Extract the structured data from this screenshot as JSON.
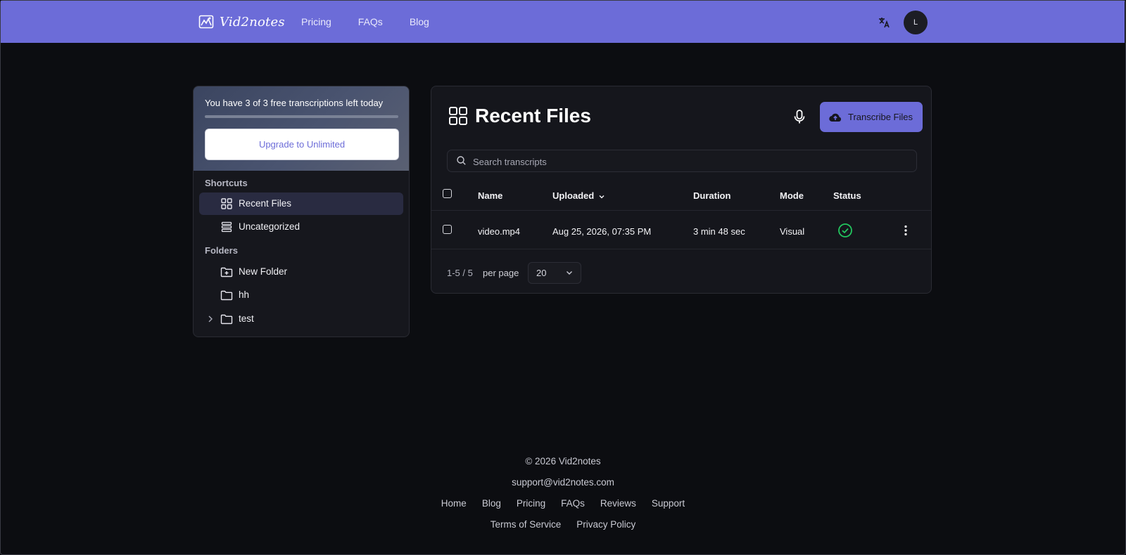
{
  "header": {
    "brand": "Vid2notes",
    "nav": [
      "Pricing",
      "FAQs",
      "Blog"
    ],
    "avatar_initial": "L",
    "bg_color": "#6c6cd8"
  },
  "sidebar": {
    "promo_text": "You have 3 of 3 free transcriptions left today",
    "quota_used_fraction": 0,
    "upgrade_label": "Upgrade to Unlimited",
    "shortcuts_label": "Shortcuts",
    "shortcuts": [
      {
        "label": "Recent Files",
        "icon": "grid-icon",
        "active": true
      },
      {
        "label": "Uncategorized",
        "icon": "stack-icon",
        "active": false
      }
    ],
    "folders_label": "Folders",
    "folders": [
      {
        "label": "New Folder",
        "icon": "folder-plus-icon"
      },
      {
        "label": "hh",
        "icon": "folder-icon"
      },
      {
        "label": "test",
        "icon": "folder-icon",
        "expandable": true
      }
    ]
  },
  "main": {
    "title": "Recent Files",
    "transcribe_label": "Transcribe Files",
    "search_placeholder": "Search transcripts",
    "columns": [
      "Name",
      "Uploaded",
      "Duration",
      "Mode",
      "Status"
    ],
    "rows": [
      {
        "name": "video.mp4",
        "uploaded": "Aug 25, 2026, 07:35 PM",
        "duration": "3 min 48 sec",
        "mode": "Visual",
        "status": "complete"
      }
    ],
    "pager": {
      "range": "1-5 / 5",
      "per_page_label": "per page",
      "per_page_value": "20"
    },
    "accent_color": "#6c6cd8",
    "status_color": "#22c55e"
  },
  "footer": {
    "copyright": "© 2026 Vid2notes",
    "email": "support@vid2notes.com",
    "links": [
      "Home",
      "Blog",
      "Pricing",
      "FAQs",
      "Reviews",
      "Support"
    ],
    "legal": [
      "Terms of Service",
      "Privacy Policy"
    ]
  }
}
